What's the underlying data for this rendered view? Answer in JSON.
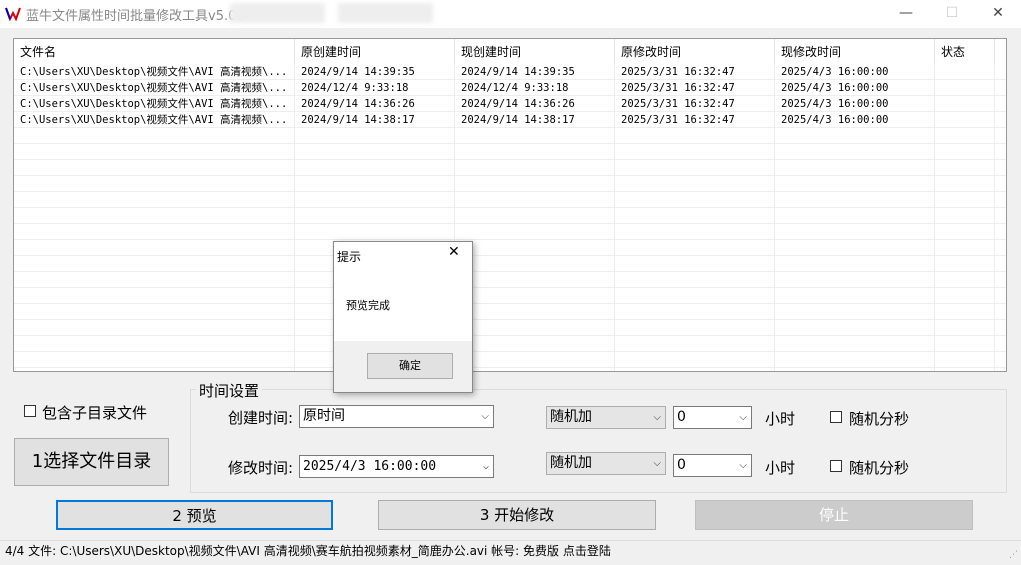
{
  "window": {
    "title": "蓝牛文件属性时间批量修改工具v5.00",
    "minimize": "—",
    "maximize": "☐",
    "close": "✕"
  },
  "list": {
    "columns": [
      "文件名",
      "原创建时间",
      "现创建时间",
      "原修改时间",
      "现修改时间",
      "状态"
    ],
    "rows": [
      [
        "C:\\Users\\XU\\Desktop\\视频文件\\AVI 高清视频\\...",
        "2024/9/14 14:39:35",
        "2024/9/14 14:39:35",
        "2025/3/31 16:32:47",
        "2025/4/3 16:00:00",
        ""
      ],
      [
        "C:\\Users\\XU\\Desktop\\视频文件\\AVI 高清视频\\...",
        "2024/12/4 9:33:18",
        "2024/12/4 9:33:18",
        "2025/3/31 16:32:47",
        "2025/4/3 16:00:00",
        ""
      ],
      [
        "C:\\Users\\XU\\Desktop\\视频文件\\AVI 高清视频\\...",
        "2024/9/14 14:36:26",
        "2024/9/14 14:36:26",
        "2025/3/31 16:32:47",
        "2025/4/3 16:00:00",
        ""
      ],
      [
        "C:\\Users\\XU\\Desktop\\视频文件\\AVI 高清视频\\...",
        "2024/9/14 14:38:17",
        "2024/9/14 14:38:17",
        "2025/3/31 16:32:47",
        "2025/4/3 16:00:00",
        ""
      ]
    ]
  },
  "options": {
    "include_subdirs": "包含子目录文件",
    "select_dir": "1选择文件目录"
  },
  "time_settings": {
    "group_title": "时间设置",
    "create_label": "创建时间:",
    "create_value": "原时间",
    "modify_label": "修改时间:",
    "modify_value": "2025/4/3 16:00:00",
    "create_mode": "随机加",
    "create_hours": "0",
    "modify_mode": "随机加",
    "modify_hours": "0",
    "hours_label": "小时",
    "random_label": "随机分秒"
  },
  "actions": {
    "preview": "2 预览",
    "start": "3 开始修改",
    "stop": "停止"
  },
  "dialog": {
    "title": "提示",
    "message": "预览完成",
    "ok": "确定",
    "close": "✕"
  },
  "status": {
    "text": "4/4 文件: C:\\Users\\XU\\Desktop\\视频文件\\AVI 高清视频\\赛车航拍视频素材_简鹿办公.avi  帐号: 免费版 点击登陆"
  }
}
